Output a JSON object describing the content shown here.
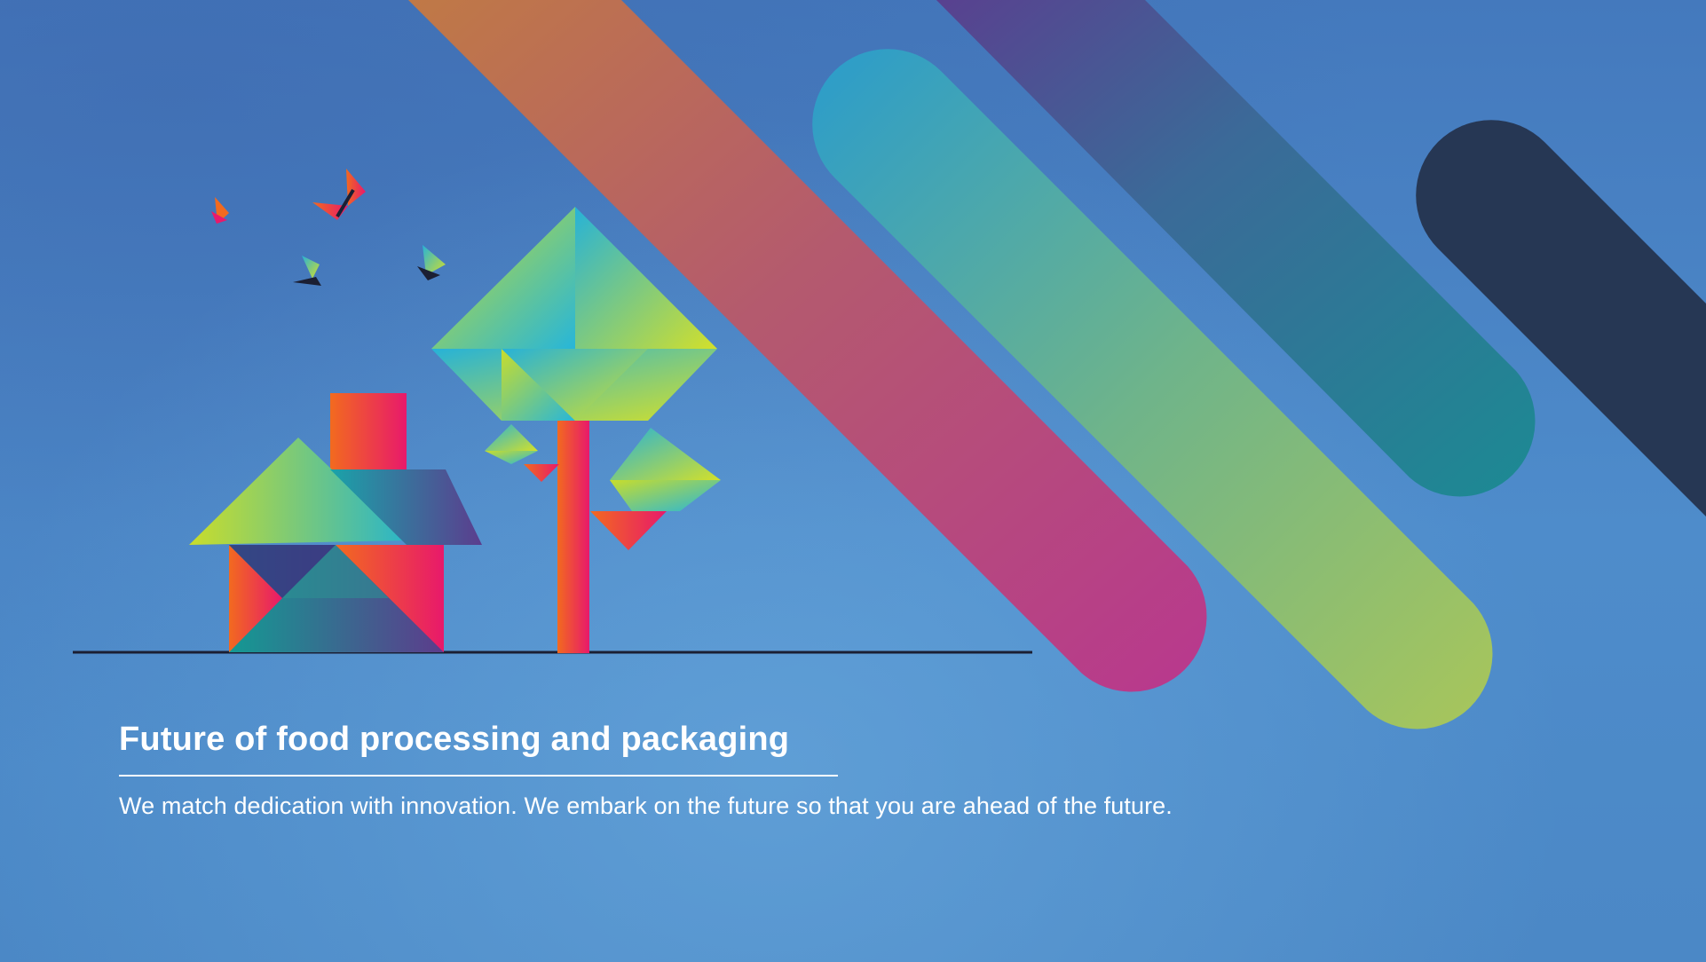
{
  "hero": {
    "title": "Future of food processing and packaging",
    "tagline": "We match dedication with innovation. We embark on the future so that you are ahead of the future."
  },
  "colors": {
    "background": "#4a86c4",
    "stripe_orange_to_magenta": [
      "#c07a45",
      "#b8388e"
    ],
    "stripe_cyan_to_lime": [
      "#2a9ccc",
      "#a7c75a"
    ],
    "stripe_purple_to_teal": [
      "#5a3f8f",
      "#1f8a92"
    ],
    "stripe_navy": "#263754",
    "text": "#ffffff"
  },
  "illustration": {
    "icons": [
      "house-icon",
      "tree-icon",
      "butterfly-icon"
    ]
  }
}
